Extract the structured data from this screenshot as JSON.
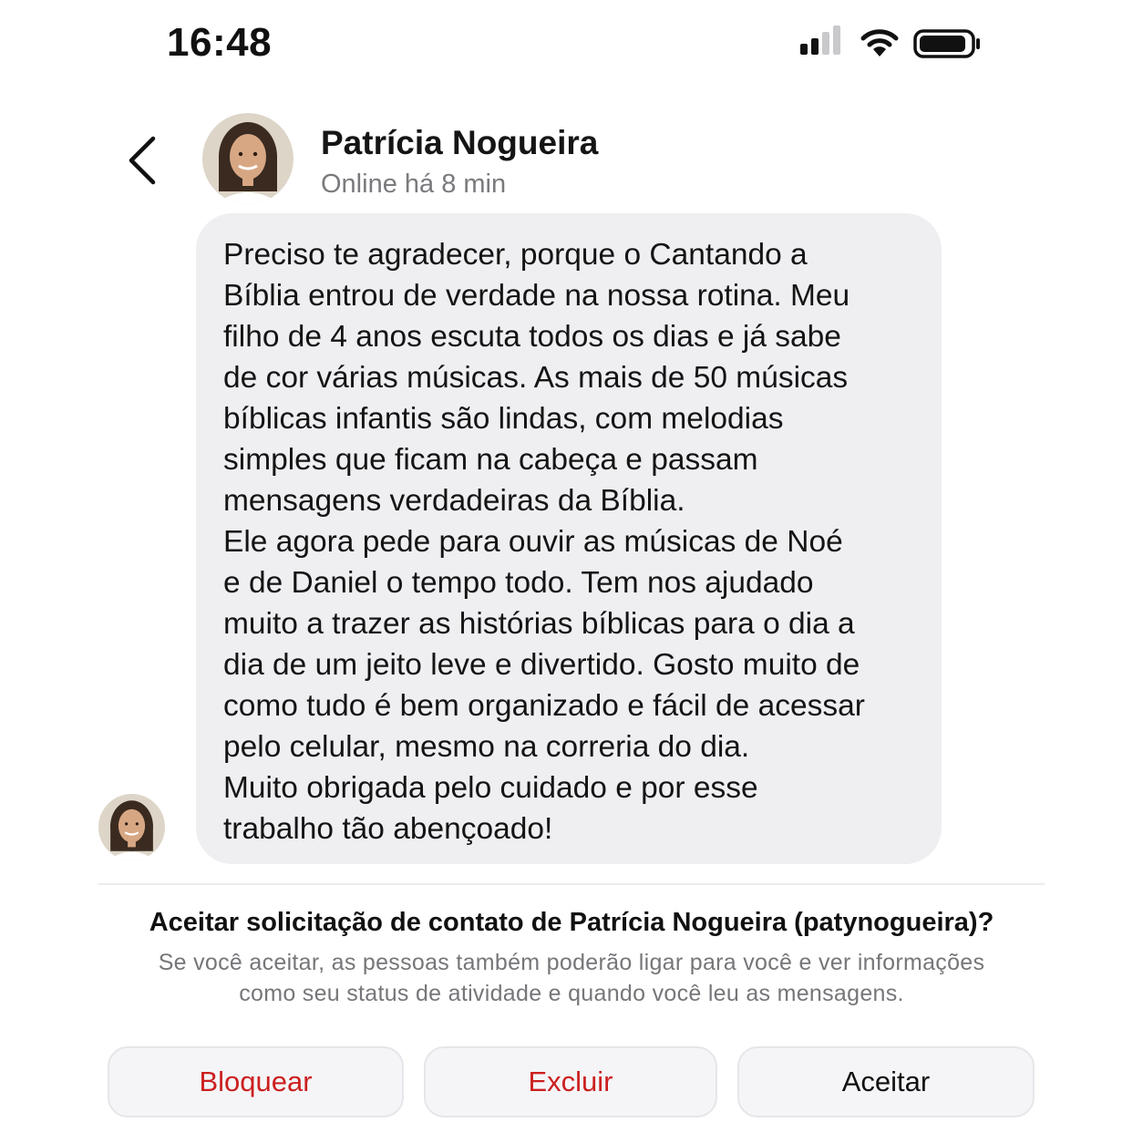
{
  "status_bar": {
    "time": "16:48",
    "icons": [
      "cellular-signal-icon",
      "wifi-icon",
      "battery-icon"
    ]
  },
  "header": {
    "back_icon": "chevron-left-icon",
    "contact_name": "Patrícia Nogueira",
    "contact_status": "Online há 8 min"
  },
  "message": {
    "text": "Preciso te agradecer, porque o Cantando a\nBíblia entrou de verdade na nossa rotina. Meu\nfilho de 4 anos escuta todos os dias e já sabe\nde cor várias músicas. As mais de 50 músicas\nbíblicas infantis são lindas, com melodias\nsimples que ficam na cabeça e passam\nmensagens verdadeiras da Bíblia.\nEle agora pede para ouvir as músicas de Noé\ne de Daniel o tempo todo. Tem nos ajudado\nmuito a trazer as histórias bíblicas para o dia a\ndia de um jeito leve e divertido. Gosto muito de\ncomo tudo é bem organizado e fácil de acessar\npelo celular, mesmo na correria do dia.\nMuito obrigada pelo cuidado e por esse\ntrabalho tão abençoado!"
  },
  "request": {
    "title": "Aceitar solicitação de contato de Patrícia Nogueira (patynogueira)?",
    "description": "Se você aceitar, as pessoas também poderão ligar para você e ver informações como seu status de atividade e quando você leu as mensagens."
  },
  "actions": {
    "block": "Bloquear",
    "delete": "Excluir",
    "accept": "Aceitar"
  },
  "colors": {
    "bubble": "#efeff2",
    "destructive": "#cc1f1f",
    "secondary_text": "#76767a"
  }
}
